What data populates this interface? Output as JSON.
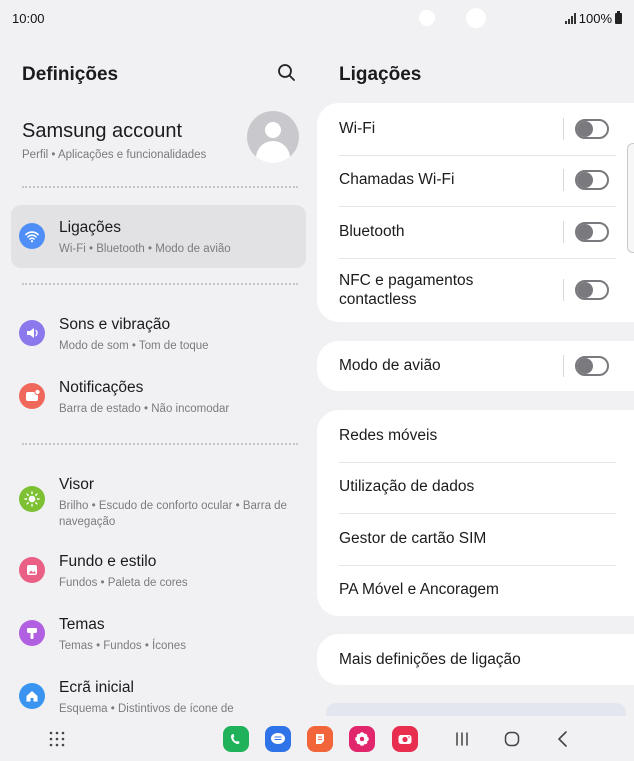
{
  "status_bar": {
    "time": "10:00",
    "battery": "100%"
  },
  "left": {
    "title": "Definições",
    "account": {
      "name": "Samsung account",
      "subtitle": "Perfil  •  Aplicações e funcionalidades"
    },
    "items": [
      {
        "title": "Ligações",
        "subtitle": "Wi-Fi  •  Bluetooth  •  Modo de avião",
        "icon": "wifi-icon",
        "color": "#4f8ef7"
      },
      {
        "title": "Sons e vibração",
        "subtitle": "Modo de som  •  Tom de toque",
        "icon": "volume-icon",
        "color": "#8a78ec"
      },
      {
        "title": "Notificações",
        "subtitle": "Barra de estado  •  Não incomodar",
        "icon": "notification-icon",
        "color": "#f0685b"
      },
      {
        "title": "Visor",
        "subtitle": "Brilho  •  Escudo de conforto ocular  •  Barra de navegação",
        "icon": "brightness-icon",
        "color": "#7dc133"
      },
      {
        "title": "Fundo e estilo",
        "subtitle": "Fundos  •  Paleta de cores",
        "icon": "wallpaper-icon",
        "color": "#ea5f86"
      },
      {
        "title": "Temas",
        "subtitle": "Temas  •  Fundos  •  Ícones",
        "icon": "themes-icon",
        "color": "#b060e0"
      },
      {
        "title": "Ecrã inicial",
        "subtitle": "Esquema  •  Distintivos de ícone de",
        "icon": "home-icon",
        "color": "#3b95f0"
      }
    ]
  },
  "right": {
    "title": "Ligações",
    "group1": [
      {
        "label": "Wi-Fi",
        "toggle": false
      },
      {
        "label": "Chamadas Wi-Fi",
        "toggle": false
      },
      {
        "label": "Bluetooth",
        "toggle": false
      },
      {
        "label": "NFC e pagamentos contactless",
        "toggle": false
      }
    ],
    "airplane": {
      "label": "Modo de avião",
      "toggle": false
    },
    "group3": [
      "Redes móveis",
      "Utilização de dados",
      "Gestor de cartão SIM",
      "PA Móvel e Ancoragem"
    ],
    "more": "Mais definições de ligação"
  },
  "dock": {
    "apps": [
      {
        "name": "phone-app-icon",
        "color": "#1fb25a"
      },
      {
        "name": "messages-app-icon",
        "color": "#2f73e8"
      },
      {
        "name": "notes-app-icon",
        "color": "#f2653a"
      },
      {
        "name": "gallery-app-icon",
        "color": "#e2266e"
      },
      {
        "name": "camera-app-icon",
        "color": "#e82d4f"
      }
    ]
  }
}
